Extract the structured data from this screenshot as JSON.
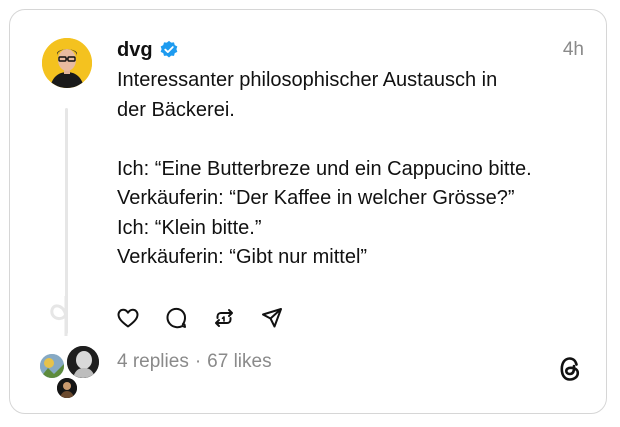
{
  "post": {
    "username": "dvg",
    "timestamp": "4h",
    "lines": [
      "Interessanter philosophischer Austausch in",
      "der Bäckerei.",
      "",
      "Ich: “Eine Butterbreze und ein Cappucino bitte.",
      "Verkäuferin: “Der Kaffee in welcher Grösse?”",
      "Ich: “Klein bitte.”",
      "Verkäuferin: “Gibt nur mittel”"
    ]
  },
  "stats": {
    "replies": "4 replies",
    "separator": "·",
    "likes": "67 likes"
  },
  "icons": {
    "verified": "verified-badge-icon",
    "like": "heart-icon",
    "reply": "comment-icon",
    "repost": "repost-icon",
    "share": "send-icon",
    "brand": "threads-logo-icon"
  },
  "colors": {
    "verified": "#1d9bf0",
    "text": "#111111",
    "muted": "#8a8a8a",
    "avatar_bg": "#f4c21f"
  }
}
